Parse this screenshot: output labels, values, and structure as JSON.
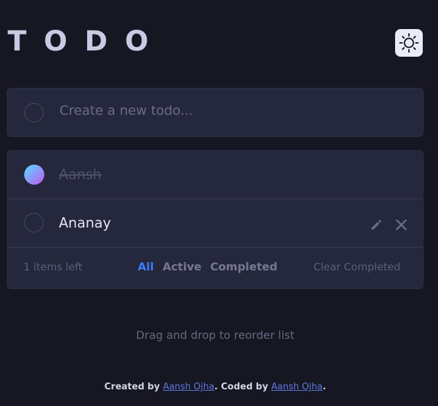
{
  "app": {
    "title": "TODO",
    "theme_toggle_icon": "sun-icon"
  },
  "new_todo": {
    "placeholder": "Create a new todo..."
  },
  "todos": [
    {
      "text": "Aansh",
      "completed": true
    },
    {
      "text": "Ananay",
      "completed": false,
      "actions": [
        "pencil-icon",
        "close-icon"
      ]
    }
  ],
  "footer": {
    "items_left": "1 items left",
    "filters": [
      "All",
      "Active",
      "Completed"
    ],
    "active_filter": "All",
    "clear_label": "Clear Completed"
  },
  "hint": "Drag and drop to reorder list",
  "credit": {
    "created_prefix": "Created by",
    "created_by": "Aansh Ojha",
    "coded_prefix": ". Coded by",
    "coded_by": "Aansh Ojha",
    "suffix": "."
  },
  "colors": {
    "background": "#171723",
    "card": "#25273c",
    "accent": "#3a7bfd",
    "gradient_start": "#57ddff",
    "gradient_end": "#c058f3"
  }
}
